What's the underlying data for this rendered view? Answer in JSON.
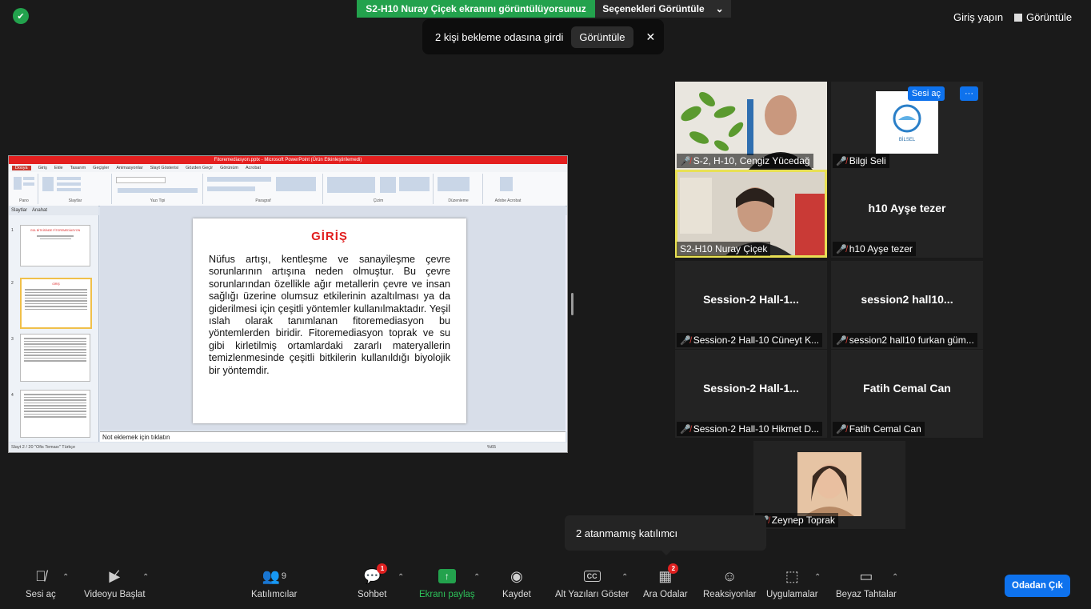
{
  "top": {
    "share_banner": "S2-H10 Nuray Çiçek ekranını görüntülüyorsunuz",
    "view_options": "Seçenekleri Görüntüle",
    "waiting_text": "2 kişi bekleme odasına girdi",
    "waiting_view": "Görüntüle",
    "sign_in": "Giriş yapın",
    "view": "Görüntüle"
  },
  "ppt": {
    "window_title": "Fitoremediasyon.pptx - Microsoft PowerPoint (Ürün Etkinleştirilemedi)",
    "tabs": [
      "Dosya",
      "Giriş",
      "Ekle",
      "Tasarım",
      "Geçişler",
      "Animasyonlar",
      "Slayt Gösterisi",
      "Gözden Geçir",
      "Görünüm",
      "Acrobat"
    ],
    "ribbon_groups": [
      "Pano",
      "Slaytlar",
      "Yazı Tipi",
      "Paragraf",
      "Çizim",
      "Düzenleme",
      "Adobe Acrobat"
    ],
    "panel_tabs": [
      "Slaytlar",
      "Anahat"
    ],
    "slide_title": "GİRİŞ",
    "slide_body": "Nüfus artışı, kentleşme ve sanayileşme çevre sorunlarının artışına neden olmuştur. Bu çevre sorunlarından özellikle ağır metallerin çevre ve insan sağlığı üzerine olumsuz etkilerinin azaltılması ya da giderilmesi için çeşitli yöntemler kullanılmaktadır. Yeşil ıslah olarak tanımlanan fitoremediasyon bu yöntemlerden biridir. Fitoremediasyon toprak ve su gibi kirletilmiş ortamlardaki zararlı materyallerin temizlenmesinde çeşitli bitkilerin kullanıldığı biyolojik bir yöntemdir.",
    "notes_placeholder": "Not eklemek için tıklatın",
    "status": "Slayt 2 / 20   \"Ofis Teması\"   Türkçe",
    "thumb1_title": "GÜL BİTKİSİNDE FİTOREMEDİASYON",
    "thumb2_title": "GİRİŞ",
    "zoom": "%65"
  },
  "tiles": [
    {
      "name": "S-2, H-10, Cengiz Yücedağ",
      "big": ""
    },
    {
      "name": "Bilgi Seli",
      "big": ""
    },
    {
      "name": "S2-H10 Nuray Çiçek",
      "big": ""
    },
    {
      "name": "h10 Ayşe tezer",
      "big": "h10 Ayşe tezer"
    },
    {
      "name": "Session-2 Hall-10 Cüneyt K...",
      "big": "Session-2  Hall-1..."
    },
    {
      "name": "session2 hall10 furkan güm...",
      "big": "session2  hall10..."
    },
    {
      "name": "Session-2 Hall-10 Hikmet D...",
      "big": "Session-2  Hall-1..."
    },
    {
      "name": "Fatih Cemal Can",
      "big": "Fatih Cemal Can"
    },
    {
      "name": "Zeynep Toprak",
      "big": ""
    }
  ],
  "tile_buttons": {
    "unmute": "Sesi aç",
    "more": "···"
  },
  "logo_text": "BİLSEL",
  "tooltip": "2 atanmamış katılımcı",
  "toolbar": {
    "mute": "Sesi aç",
    "video": "Videoyu Başlat",
    "participants": "Katılımcılar",
    "participants_count": "9",
    "chat": "Sohbet",
    "chat_badge": "1",
    "share": "Ekranı paylaş",
    "record": "Kaydet",
    "captions": "Alt Yazıları Göster",
    "breakout": "Ara Odalar",
    "breakout_badge": "2",
    "reactions": "Reaksiyonlar",
    "apps": "Uygulamalar",
    "whiteboard": "Beyaz Tahtalar",
    "leave": "Odadan Çık"
  }
}
